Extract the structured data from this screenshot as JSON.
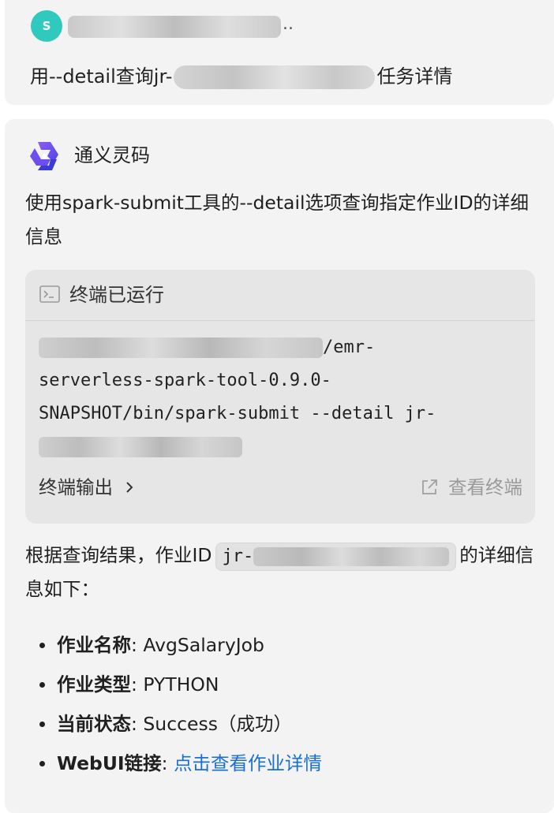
{
  "user_message": {
    "avatar_letter": "S",
    "name_suffix": "..",
    "text_prefix": "用--detail查询jr-",
    "text_suffix": "任务详情"
  },
  "assistant": {
    "name": "通义灵码",
    "intro": "使用spark-submit工具的--detail选项查询指定作业ID的详细信息",
    "terminal": {
      "title": "终端已运行",
      "command_line1_suffix": "/emr-",
      "command_line2": "serverless-spark-tool-0.9.0-",
      "command_line3": "SNAPSHOT/bin/spark-submit --detail jr-",
      "output_label": "终端输出",
      "view_label": "查看终端"
    },
    "result_prefix": "根据查询结果，作业ID",
    "result_job_prefix": "jr-",
    "result_suffix": "的详细信息如下：",
    "details": [
      {
        "key": "作业名称",
        "sep": ": ",
        "value": "AvgSalaryJob"
      },
      {
        "key": "作业类型",
        "sep": ": ",
        "value": "PYTHON"
      },
      {
        "key": "当前状态",
        "sep": ": ",
        "value": "Success（成功）"
      },
      {
        "key": "WebUI链接",
        "sep": ": ",
        "value": "点击查看作业详情"
      }
    ]
  },
  "colors": {
    "avatar": "#2fc9bd",
    "card_background": "#f3f3f3",
    "terminal_background": "#e6e6e6",
    "link": "#1a6fd6"
  }
}
